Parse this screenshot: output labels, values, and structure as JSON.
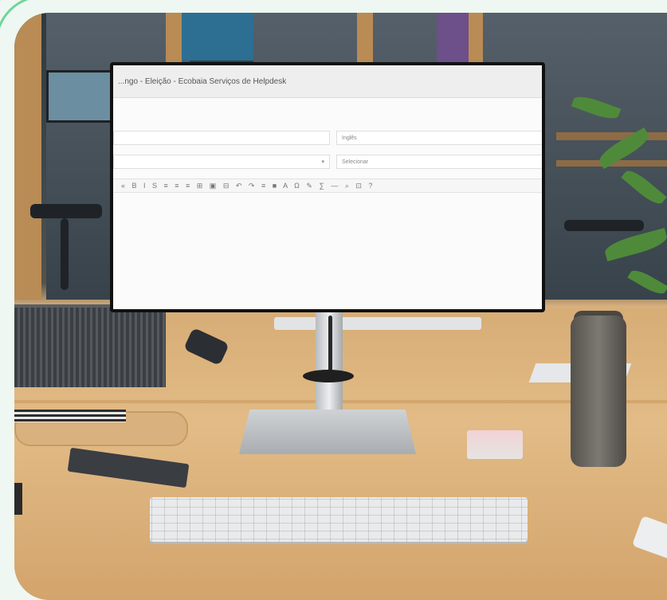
{
  "monitor": {
    "window_title": "...ngo - Eleição - Ecobaia Serviços de Helpdesk",
    "fields": {
      "subject_right": "Inglês",
      "select_right": "Selecionar"
    },
    "toolbar_glyphs": "« B I S ≡ ≡ ≡ ⊞ ▣ ⊟ ↶ ↷ ≡ ■ A Ω ✎ ∑ — ⌕ ⊡ ?"
  },
  "colors": {
    "background": "#eef7f1",
    "accent": "#6fd59a",
    "desk": "#e2bb86",
    "monitor_bezel": "#111111"
  }
}
